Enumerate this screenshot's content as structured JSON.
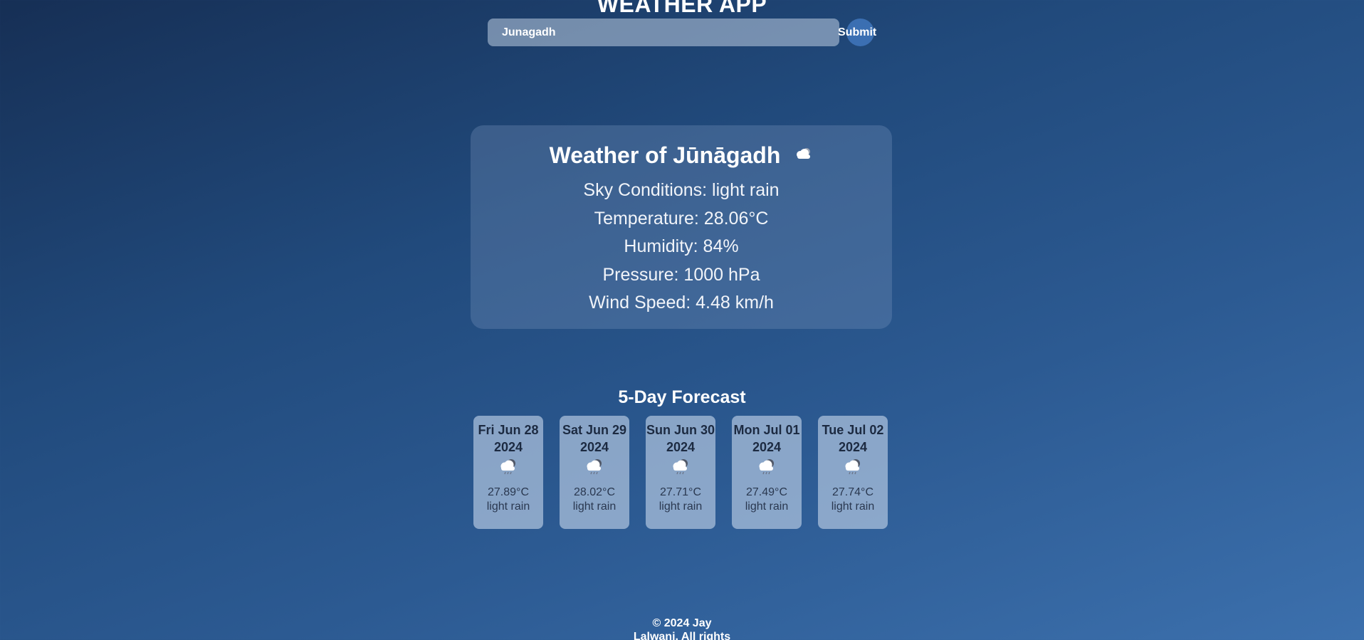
{
  "app": {
    "title": "WEATHER APP"
  },
  "search": {
    "value": "Junagadh",
    "submit_label": "Submit"
  },
  "current": {
    "title": "Weather of Jūnāgadh",
    "icon": "cloud-icon",
    "lines": [
      "Sky Conditions: light rain",
      "Temperature: 28.06°C",
      "Humidity: 84%",
      "Pressure: 1000 hPa",
      "Wind Speed: 4.48 km/h"
    ]
  },
  "forecast": {
    "heading": "5-Day Forecast",
    "days": [
      {
        "date": "Fri Jun 28 2024",
        "icon": "rain-cloud-icon",
        "temp": "27.89°C",
        "desc": "light rain"
      },
      {
        "date": "Sat Jun 29 2024",
        "icon": "rain-cloud-icon",
        "temp": "28.02°C",
        "desc": "light rain"
      },
      {
        "date": "Sun Jun 30 2024",
        "icon": "rain-cloud-icon",
        "temp": "27.71°C",
        "desc": "light rain"
      },
      {
        "date": "Mon Jul 01 2024",
        "icon": "rain-cloud-icon",
        "temp": "27.49°C",
        "desc": "light rain"
      },
      {
        "date": "Tue Jul 02 2024",
        "icon": "rain-cloud-icon",
        "temp": "27.74°C",
        "desc": "light rain"
      }
    ]
  },
  "footer": {
    "text": "© 2024 Jay Lalwani. All rights"
  }
}
